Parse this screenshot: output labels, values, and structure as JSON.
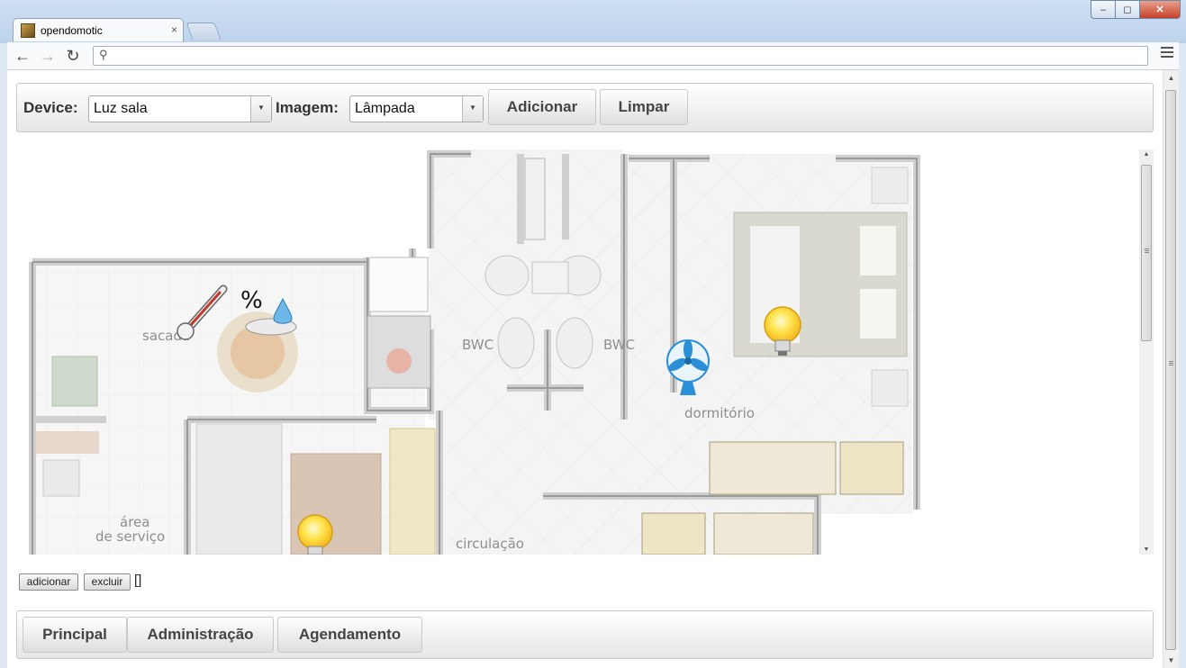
{
  "browser": {
    "tab_title": "opendomotic",
    "tab_close": "×",
    "address": "",
    "win_min": "‒",
    "win_max": "◻",
    "win_close": "✕"
  },
  "toolbar": {
    "device_label": "Device:",
    "device_value": "Luz sala",
    "image_label": "Imagem:",
    "image_value": "Lâmpada",
    "add_button": "Adicionar",
    "clear_button": "Limpar"
  },
  "floorplan": {
    "rooms": {
      "sacada": "sacada",
      "bwc_left": "BWC",
      "bwc_right": "BWC",
      "dormitorio": "dormitório",
      "area_1": "área",
      "area_2": "de serviço",
      "circulacao": "circulação"
    },
    "devices": [
      {
        "name": "temperature-sensor",
        "icon": "thermometer-icon"
      },
      {
        "name": "humidity-sensor",
        "label": "%",
        "icon": "humidity-icon"
      },
      {
        "name": "bedroom-light",
        "icon": "lightbulb-icon"
      },
      {
        "name": "bedroom-fan",
        "icon": "fan-icon"
      },
      {
        "name": "service-light",
        "icon": "lightbulb-icon"
      }
    ]
  },
  "actions": {
    "add": "adicionar",
    "delete": "excluir",
    "list": "[]"
  },
  "nav": {
    "principal": "Principal",
    "admin": "Administração",
    "schedule": "Agendamento"
  },
  "colors": {
    "toolbar_top": "#ffffff",
    "toolbar_bottom": "#e6e6e6",
    "bulb": "#ffd43a",
    "fan": "#2a8fd6",
    "thermo": "#c0392b"
  }
}
